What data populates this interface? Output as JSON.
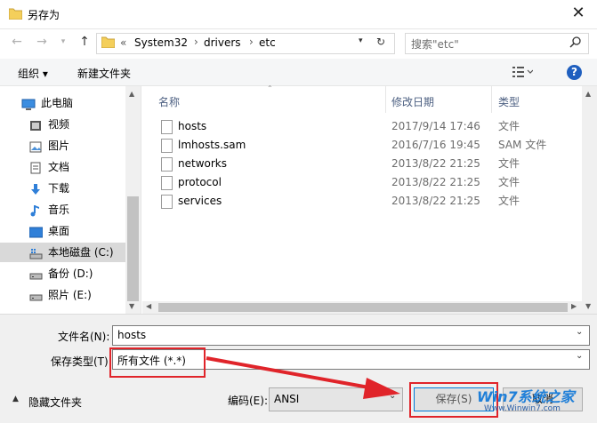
{
  "window": {
    "title": "另存为",
    "close_glyph": "✕"
  },
  "nav": {
    "path_prefix": "«",
    "path": [
      "System32",
      "drivers",
      "etc"
    ],
    "search_placeholder": "搜索\"etc\""
  },
  "toolbar": {
    "organize": "组织 ▾",
    "new_folder": "新建文件夹"
  },
  "sidebar": {
    "items": [
      {
        "label": "此电脑",
        "icon": "computer-icon"
      },
      {
        "label": "视频",
        "icon": "video-icon"
      },
      {
        "label": "图片",
        "icon": "picture-icon"
      },
      {
        "label": "文档",
        "icon": "document-icon"
      },
      {
        "label": "下载",
        "icon": "download-icon"
      },
      {
        "label": "音乐",
        "icon": "music-icon"
      },
      {
        "label": "桌面",
        "icon": "desktop-icon"
      },
      {
        "label": "本地磁盘 (C:)",
        "icon": "drive-icon"
      },
      {
        "label": "备份 (D:)",
        "icon": "drive-icon"
      },
      {
        "label": "照片 (E:)",
        "icon": "drive-icon"
      }
    ]
  },
  "columns": {
    "name": "名称",
    "date": "修改日期",
    "type": "类型"
  },
  "files": [
    {
      "name": "hosts",
      "date": "2017/9/14 17:46",
      "type": "文件"
    },
    {
      "name": "lmhosts.sam",
      "date": "2016/7/16 19:45",
      "type": "SAM 文件"
    },
    {
      "name": "networks",
      "date": "2013/8/22 21:25",
      "type": "文件"
    },
    {
      "name": "protocol",
      "date": "2013/8/22 21:25",
      "type": "文件"
    },
    {
      "name": "services",
      "date": "2013/8/22 21:25",
      "type": "文件"
    }
  ],
  "form": {
    "filename_label": "文件名(N):",
    "filename_value": "hosts",
    "savetype_label": "保存类型(T):",
    "savetype_value": "所有文件  (*.*)",
    "hide_folders": "隐藏文件夹",
    "encoding_label": "编码(E):",
    "encoding_value": "ANSI",
    "save_button": "保存(S)",
    "cancel_button": "取消"
  },
  "watermark": {
    "site": "Win7系统之家",
    "url": "Www.Winwin7.com"
  },
  "colors": {
    "accent": "#0078d7",
    "highlight_red": "#e0242a"
  }
}
